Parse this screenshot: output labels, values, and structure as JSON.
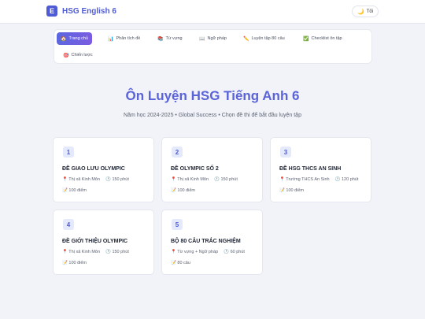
{
  "header": {
    "logo_letter": "E",
    "brand": "HSG English 6",
    "theme_icon": "moon-icon",
    "theme_label": "Tối"
  },
  "nav": {
    "items": [
      {
        "icon": "home-icon",
        "glyph": "🏠",
        "label": "Trang chủ",
        "active": true
      },
      {
        "icon": "chart-icon",
        "glyph": "📊",
        "label": "Phân tích đề",
        "active": false
      },
      {
        "icon": "books-icon",
        "glyph": "📚",
        "label": "Từ vựng",
        "active": false
      },
      {
        "icon": "book-icon",
        "glyph": "📖",
        "label": "Ngữ pháp",
        "active": false
      },
      {
        "icon": "pencil-icon",
        "glyph": "✏️",
        "label": "Luyện tập 80 câu",
        "active": false
      },
      {
        "icon": "check-icon",
        "glyph": "✅",
        "label": "Checklist ôn tập",
        "active": false
      },
      {
        "icon": "target-icon",
        "glyph": "🎯",
        "label": "Chiến lược",
        "active": false
      }
    ]
  },
  "hero": {
    "title": "Ôn Luyện HSG Tiếng Anh 6",
    "subtitle": "Năm học 2024-2025 • Global Success • Chọn đề thi để bắt đầu luyện tập"
  },
  "cards": [
    {
      "num": "1",
      "title": "ĐỀ GIAO LƯU OLYMPIC",
      "location": "Thị xã Kinh Môn",
      "duration": "150 phút",
      "score": "100 điểm"
    },
    {
      "num": "2",
      "title": "ĐỀ OLYMPIC SỐ 2",
      "location": "Thị xã Kinh Môn",
      "duration": "150 phút",
      "score": "100 điểm"
    },
    {
      "num": "3",
      "title": "ĐỀ HSG THCS AN SINH",
      "location": "Trường THCS An Sinh",
      "duration": "120 phút",
      "score": "100 điểm"
    },
    {
      "num": "4",
      "title": "ĐỀ GIỚI THIỆU OLYMPIC",
      "location": "Thị xã Kinh Môn",
      "duration": "150 phút",
      "score": "100 điểm"
    },
    {
      "num": "5",
      "title": "BỘ 80 CÂU TRẮC NGHIỆM",
      "location": "Từ vựng + Ngữ pháp",
      "duration": "60 phút",
      "score": "80 câu"
    }
  ],
  "colors": {
    "accent": "#4f5bd5",
    "title": "#5a63d8",
    "background": "#f1f3f8"
  }
}
